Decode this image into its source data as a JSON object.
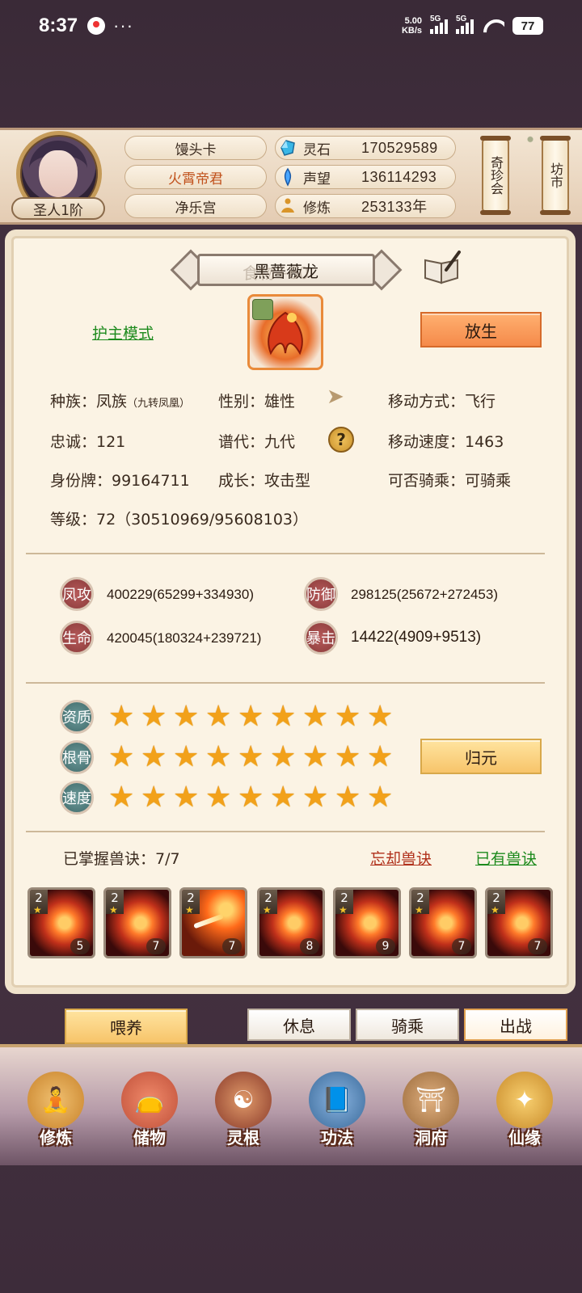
{
  "status_bar": {
    "time": "8:37",
    "more": "···",
    "net_speed": "5.00",
    "net_unit": "KB/s",
    "sig1": "5G",
    "sig2": "5G",
    "wifi_label": "6",
    "battery": "77"
  },
  "player": {
    "rank": "圣人1阶",
    "names": [
      "馒头卡",
      "火霄帝君",
      "净乐宫"
    ],
    "resources": [
      {
        "icon": "spirit-stone-icon",
        "label": "灵石",
        "value": "170529589"
      },
      {
        "icon": "prestige-icon",
        "label": "声望",
        "value": "136114293"
      },
      {
        "icon": "meditation-icon",
        "label": "修炼",
        "value": "253133年"
      }
    ],
    "side_buttons": [
      {
        "label": "奇珍会"
      },
      {
        "label": "坊市"
      }
    ]
  },
  "pet": {
    "name": "黑蔷薇龙",
    "ghost_text": "食物+60",
    "guard_mode": "护主模式",
    "release_button": "放生",
    "info": {
      "race": "种族：凤族",
      "race_sub": "（九转凤凰）",
      "gender": "性别：雄性",
      "move_type": "移动方式：飞行",
      "loyalty": "忠诚：121",
      "generation": "谱代：九代",
      "move_speed": "移动速度：1463",
      "id": "身份牌：99164711",
      "growth": "成长：攻击型",
      "rideable": "可否骑乘：可骑乘",
      "level": "等级：72（30510969/95608103）"
    },
    "stats": [
      {
        "badge": "凤攻",
        "value": "400229(65299+334930)"
      },
      {
        "badge": "防御",
        "value": "298125(25672+272453)"
      },
      {
        "badge": "生命",
        "value": "420045(180324+239721)"
      },
      {
        "badge": "暴击",
        "value": "14422(4909+9513)"
      }
    ],
    "aptitudes": [
      {
        "badge": "资质",
        "stars": 9
      },
      {
        "badge": "根骨",
        "stars": 9
      },
      {
        "badge": "速度",
        "stars": 9
      }
    ],
    "return_button": "归元",
    "skills_mastered": "已掌握兽诀：7/7",
    "forget_skills": "忘却兽诀",
    "owned_skills": "已有兽诀",
    "skills": [
      {
        "level": "2",
        "count": "5"
      },
      {
        "level": "2",
        "count": "7"
      },
      {
        "level": "2",
        "count": "7"
      },
      {
        "level": "2",
        "count": "8"
      },
      {
        "level": "2",
        "count": "9"
      },
      {
        "level": "2",
        "count": "7"
      },
      {
        "level": "2",
        "count": "7"
      }
    ],
    "actions": {
      "feed": "喂养",
      "rest": "休息",
      "ride": "骑乘",
      "battle": "出战"
    }
  },
  "nav": [
    {
      "label": "修炼",
      "icon": "cultivate-icon",
      "color": "#c8822a"
    },
    {
      "label": "储物",
      "icon": "storage-bag-icon",
      "color": "#c0503a"
    },
    {
      "label": "灵根",
      "icon": "spirit-root-icon",
      "color": "#8a3a2a"
    },
    {
      "label": "功法",
      "icon": "scripture-book-icon",
      "color": "#3a6a9a"
    },
    {
      "label": "洞府",
      "icon": "cave-mansion-icon",
      "color": "#9a6a3a"
    },
    {
      "label": "仙缘",
      "icon": "immortal-fate-icon",
      "color": "#c88a2a"
    }
  ]
}
